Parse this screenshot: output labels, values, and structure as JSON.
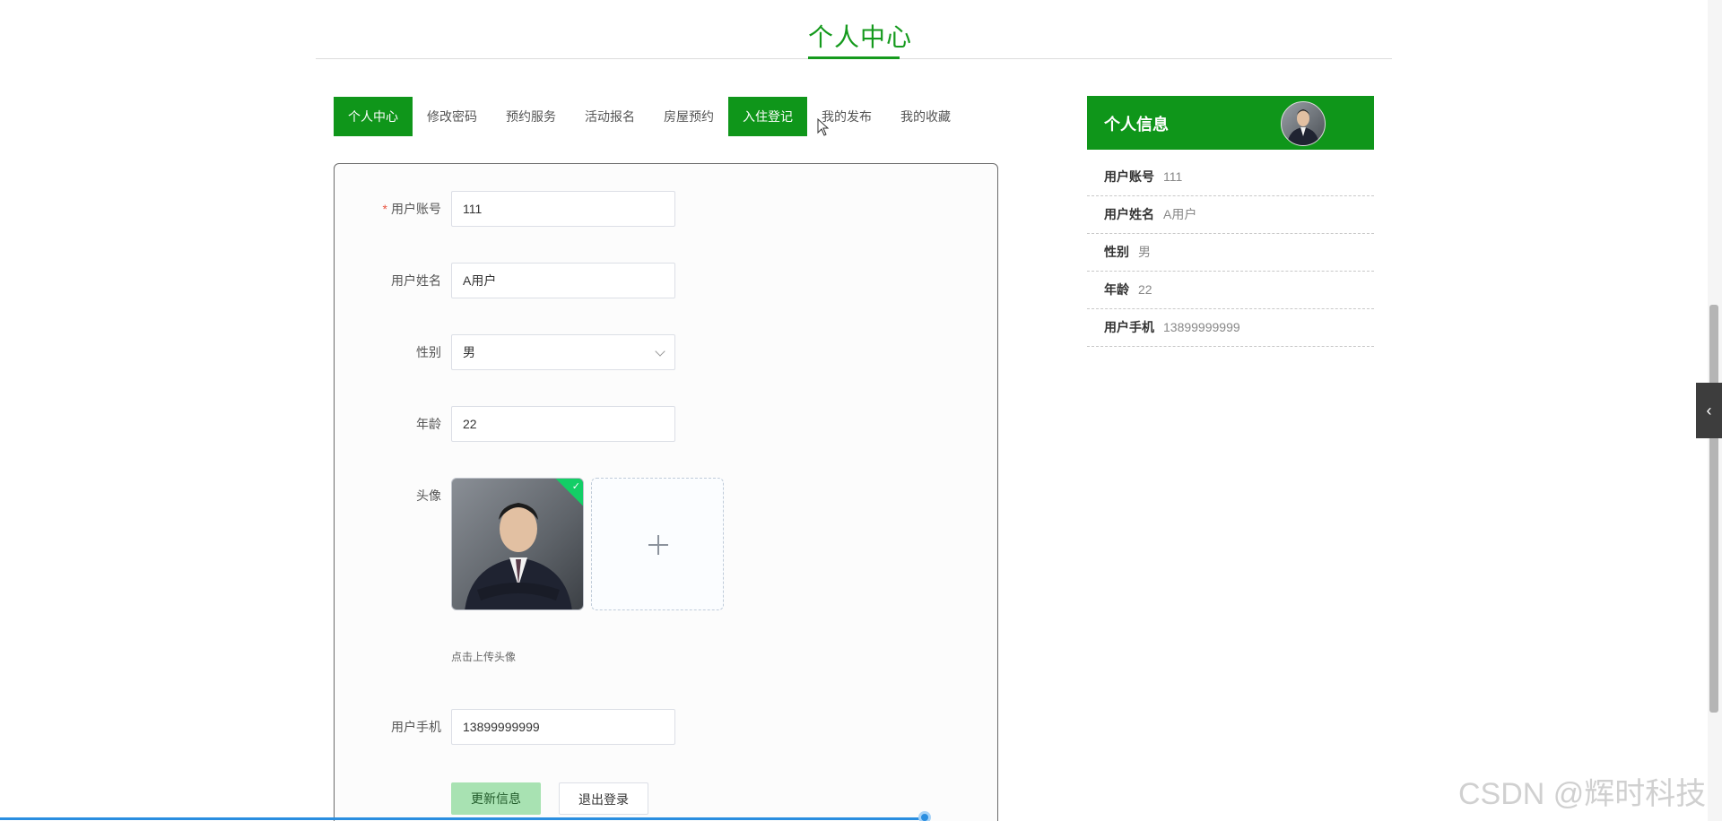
{
  "page": {
    "title": "个人中心"
  },
  "tabs": [
    {
      "label": "个人中心",
      "active": true
    },
    {
      "label": "修改密码",
      "active": false
    },
    {
      "label": "预约服务",
      "active": false
    },
    {
      "label": "活动报名",
      "active": false
    },
    {
      "label": "房屋预约",
      "active": false
    },
    {
      "label": "入住登记",
      "active": true
    },
    {
      "label": "我的发布",
      "active": false
    },
    {
      "label": "我的收藏",
      "active": false
    }
  ],
  "form": {
    "account": {
      "required_mark": "*",
      "label": "用户账号",
      "value": "111"
    },
    "name": {
      "label": "用户姓名",
      "value": "A用户"
    },
    "gender": {
      "label": "性别",
      "value": "男"
    },
    "age": {
      "label": "年龄",
      "value": "22"
    },
    "avatar": {
      "label": "头像",
      "hint": "点击上传头像",
      "upload_icon": "plus-icon",
      "uploaded_icon": "check-icon"
    },
    "phone": {
      "label": "用户手机",
      "value": "13899999999"
    },
    "update_button": "更新信息",
    "logout_button": "退出登录"
  },
  "info_card": {
    "title": "个人信息",
    "items": [
      {
        "key": "用户账号",
        "value": "111"
      },
      {
        "key": "用户姓名",
        "value": "A用户"
      },
      {
        "key": "性别",
        "value": "男"
      },
      {
        "key": "年龄",
        "value": "22"
      },
      {
        "key": "用户手机",
        "value": "13899999999"
      }
    ]
  },
  "side_toggle": {
    "icon": "chevron-left-icon",
    "glyph": "‹"
  },
  "watermark": "CSDN @辉时科技",
  "colors": {
    "accent": "#0f961a",
    "title_green": "#159a1d",
    "primary_button": "#a8e2b2"
  }
}
